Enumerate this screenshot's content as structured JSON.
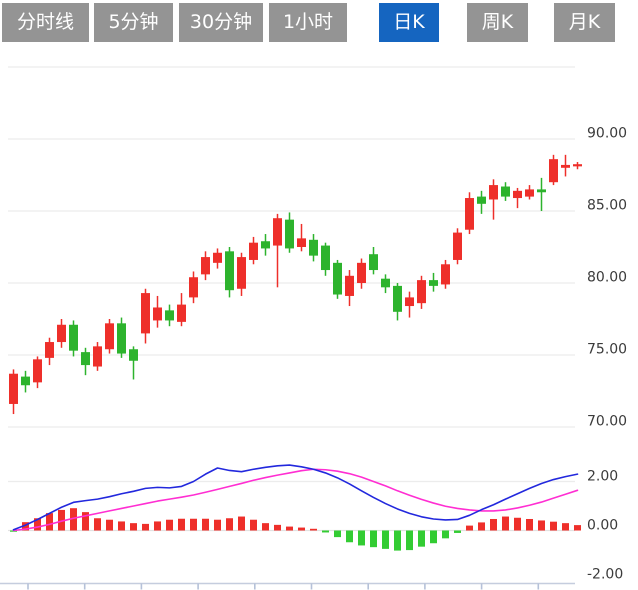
{
  "tabs": {
    "colors": {
      "bg": "#949494",
      "active_bg": "#1565c0",
      "text": "#ffffff"
    },
    "items": [
      {
        "id": "timeline",
        "label": "分时线",
        "selected": false
      },
      {
        "id": "5min",
        "label": "5分钟",
        "selected": false
      },
      {
        "id": "30min",
        "label": "30分钟",
        "selected": false
      },
      {
        "id": "1hour",
        "label": "1小时",
        "selected": false
      },
      {
        "id": "daily-k",
        "label": "日K",
        "selected": true
      },
      {
        "id": "weekly-k",
        "label": "周K",
        "selected": false
      },
      {
        "id": "monthly-k",
        "label": "月K",
        "selected": false
      }
    ]
  },
  "chart_data": {
    "type": "candlestick",
    "subtype": "kline-with-macd",
    "price_axis": {
      "labels": [
        "90.00",
        "85.00",
        "80.00",
        "75.00",
        "70.00"
      ],
      "values": [
        90,
        85,
        80,
        75,
        70
      ],
      "grid_values": [
        95,
        90,
        85,
        80,
        75,
        70
      ],
      "range": [
        68.5,
        95
      ]
    },
    "indicator_axis": {
      "labels": [
        "2.00",
        "0.00",
        "-2.00"
      ],
      "values": [
        2,
        0,
        -2
      ],
      "range": [
        -2.4,
        2.9
      ]
    },
    "x_axis": {
      "tick_count": 10,
      "labels": []
    },
    "candles": {
      "comment_format": "[open, high, low, close]",
      "ohlc": [
        [
          71.6,
          74.0,
          70.9,
          73.7
        ],
        [
          73.5,
          73.9,
          72.4,
          72.9
        ],
        [
          73.1,
          74.9,
          72.7,
          74.7
        ],
        [
          74.8,
          76.2,
          74.3,
          75.9
        ],
        [
          75.9,
          77.5,
          75.5,
          77.1
        ],
        [
          77.1,
          77.4,
          74.9,
          75.3
        ],
        [
          75.2,
          75.5,
          73.6,
          74.3
        ],
        [
          74.2,
          75.9,
          73.9,
          75.6
        ],
        [
          75.4,
          77.5,
          75.1,
          77.2
        ],
        [
          77.2,
          77.6,
          74.8,
          75.1
        ],
        [
          75.4,
          75.6,
          73.3,
          74.6
        ],
        [
          76.5,
          79.6,
          75.8,
          79.3
        ],
        [
          77.4,
          79.1,
          76.9,
          78.3
        ],
        [
          78.1,
          78.5,
          77.0,
          77.4
        ],
        [
          77.3,
          79.3,
          77.0,
          78.5
        ],
        [
          79.0,
          80.8,
          78.6,
          80.4
        ],
        [
          80.6,
          82.2,
          80.2,
          81.8
        ],
        [
          81.4,
          82.4,
          81.0,
          82.1
        ],
        [
          82.2,
          82.5,
          79.0,
          79.5
        ],
        [
          79.6,
          82.1,
          79.1,
          81.8
        ],
        [
          81.6,
          83.2,
          81.3,
          82.8
        ],
        [
          82.9,
          83.4,
          81.9,
          82.4
        ],
        [
          82.6,
          84.8,
          79.7,
          84.5
        ],
        [
          84.4,
          84.9,
          82.1,
          82.4
        ],
        [
          82.5,
          84.1,
          82.2,
          83.1
        ],
        [
          83.0,
          83.4,
          81.5,
          81.9
        ],
        [
          82.6,
          82.8,
          80.5,
          80.9
        ],
        [
          81.4,
          81.6,
          78.9,
          79.2
        ],
        [
          79.1,
          80.9,
          78.4,
          80.5
        ],
        [
          80.0,
          81.7,
          79.6,
          81.4
        ],
        [
          82.0,
          82.5,
          80.6,
          80.9
        ],
        [
          80.3,
          80.6,
          79.3,
          79.7
        ],
        [
          79.8,
          80.0,
          77.4,
          78.0
        ],
        [
          78.4,
          79.4,
          77.6,
          79.0
        ],
        [
          78.6,
          80.5,
          78.2,
          80.2
        ],
        [
          80.2,
          80.7,
          79.4,
          79.8
        ],
        [
          79.9,
          81.6,
          79.6,
          81.3
        ],
        [
          81.6,
          83.8,
          81.3,
          83.5
        ],
        [
          83.7,
          86.3,
          83.4,
          85.9
        ],
        [
          86.0,
          86.4,
          84.8,
          85.5
        ],
        [
          85.8,
          87.2,
          84.4,
          86.8
        ],
        [
          86.7,
          87.0,
          85.7,
          86.0
        ],
        [
          85.9,
          86.6,
          85.2,
          86.4
        ],
        [
          86.0,
          86.8,
          85.8,
          86.5
        ],
        [
          86.5,
          87.3,
          85.0,
          86.3
        ],
        [
          87.0,
          88.9,
          86.8,
          88.6
        ],
        [
          88.0,
          88.9,
          87.4,
          88.2
        ],
        [
          88.1,
          88.4,
          87.9,
          88.25
        ]
      ]
    },
    "macd": {
      "dif": [
        0.03,
        0.22,
        0.45,
        0.7,
        0.95,
        1.15,
        1.22,
        1.28,
        1.38,
        1.5,
        1.6,
        1.72,
        1.76,
        1.74,
        1.8,
        2.0,
        2.3,
        2.55,
        2.45,
        2.4,
        2.5,
        2.58,
        2.64,
        2.67,
        2.6,
        2.5,
        2.35,
        2.15,
        1.9,
        1.62,
        1.35,
        1.1,
        0.88,
        0.7,
        0.56,
        0.47,
        0.43,
        0.45,
        0.62,
        0.85,
        1.05,
        1.28,
        1.5,
        1.72,
        1.92,
        2.08,
        2.2,
        2.3
      ],
      "dea": [
        0.0,
        0.06,
        0.14,
        0.25,
        0.38,
        0.5,
        0.6,
        0.7,
        0.8,
        0.9,
        1.0,
        1.1,
        1.2,
        1.28,
        1.36,
        1.45,
        1.56,
        1.68,
        1.8,
        1.92,
        2.05,
        2.16,
        2.26,
        2.35,
        2.44,
        2.5,
        2.48,
        2.42,
        2.32,
        2.18,
        2.0,
        1.82,
        1.62,
        1.44,
        1.27,
        1.12,
        0.99,
        0.9,
        0.84,
        0.8,
        0.8,
        0.84,
        0.92,
        1.03,
        1.16,
        1.32,
        1.48,
        1.64
      ],
      "histogram": [
        -0.05,
        0.34,
        0.5,
        0.71,
        0.84,
        0.91,
        0.75,
        0.5,
        0.44,
        0.37,
        0.3,
        0.27,
        0.37,
        0.44,
        0.48,
        0.48,
        0.48,
        0.44,
        0.5,
        0.57,
        0.44,
        0.3,
        0.23,
        0.16,
        0.12,
        0.07,
        -0.08,
        -0.27,
        -0.48,
        -0.61,
        -0.68,
        -0.75,
        -0.82,
        -0.8,
        -0.66,
        -0.52,
        -0.32,
        -0.1,
        0.2,
        0.33,
        0.47,
        0.57,
        0.52,
        0.47,
        0.41,
        0.36,
        0.3,
        0.22
      ]
    },
    "colors": {
      "up": "#ee2f2a",
      "down": "#2db32d",
      "hist_up": "#ee2f2a",
      "hist_down": "#33cc33",
      "dif_line": "#2228dd",
      "dea_line": "#ff2ed2",
      "grid": "#ececec",
      "zero_line": "#e2e2e2",
      "axis_line": "#c5cdde",
      "tick": "#b5c1d8",
      "label": "#3b3b3b"
    }
  }
}
